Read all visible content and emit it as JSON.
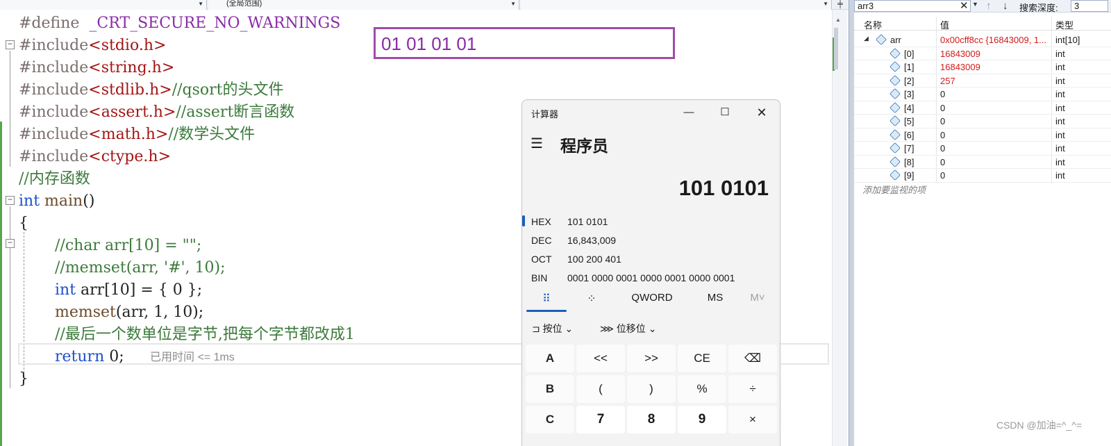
{
  "nav": {
    "combo_middle": "(全局范围)",
    "split_icon": "split-icon"
  },
  "code": {
    "lines": [
      {
        "pp": "#define",
        "rest": "_CRT_SECURE_NO_WARNINGS"
      },
      {
        "pp": "#include",
        "inc": "<stdio.h>"
      },
      {
        "pp": "#include",
        "inc": "<string.h>"
      },
      {
        "pp": "#include",
        "inc": "<stdlib.h>",
        "com": "//qsort的头文件"
      },
      {
        "pp": "#include",
        "inc": "<assert.h>",
        "com": "//assert断言函数"
      },
      {
        "pp": "#include",
        "inc": "<math.h>",
        "com": "//数学头文件"
      },
      {
        "pp": "#include",
        "inc": "<ctype.h>"
      },
      {
        "com": "//内存函数"
      },
      {
        "kw": "int",
        "fn": "main",
        "txt": "()"
      },
      {
        "txt": "{"
      },
      {
        "com": "//char arr[10] = \"\";"
      },
      {
        "com": "//memset(arr, '#', 10);"
      },
      {
        "kw": "int",
        "txt": " arr[10] = { 0 };"
      },
      {
        "fn": "memset",
        "txt": "(arr, 1, 10);"
      },
      {
        "com": "//最后一个数单位是字节,把每个字节都改成1"
      },
      {
        "kw": "return",
        "txt": " 0;"
      },
      {
        "txt": "}"
      }
    ],
    "elapsed_hint": "已用时间 <= 1ms"
  },
  "memory": {
    "text": "01 01 01 01"
  },
  "calculator": {
    "title": "计算器",
    "mode": "程序员",
    "display": "101 0101",
    "radix": [
      {
        "label": "HEX",
        "value": "101 0101"
      },
      {
        "label": "DEC",
        "value": "16,843,009"
      },
      {
        "label": "OCT",
        "value": "100 200 401"
      },
      {
        "label": "BIN",
        "value": "0001 0000 0001 0000 0001 0000 0001"
      }
    ],
    "tabs": {
      "keypad_icon": "keypad-icon",
      "bitflip_icon": "bit-toggle-icon",
      "word": "QWORD",
      "ms": "MS",
      "mv": "M˅"
    },
    "ops": {
      "bitwise": "按位",
      "shift": "位移位"
    },
    "keys": [
      [
        "A",
        "<<",
        ">>",
        "CE",
        "⌫"
      ],
      [
        "B",
        "(",
        ")",
        "%",
        "÷"
      ],
      [
        "C",
        "7",
        "8",
        "9",
        "×"
      ]
    ]
  },
  "watch": {
    "search_value": "arr3",
    "depth_label": "搜索深度:",
    "depth_value": "3",
    "headers": {
      "name": "名称",
      "value": "值",
      "type": "类型"
    },
    "root": {
      "name": "arr",
      "value": "0x00cff8cc {16843009, 1...",
      "type": "int[10]"
    },
    "items": [
      {
        "name": "[0]",
        "value": "16843009",
        "type": "int",
        "changed": true
      },
      {
        "name": "[1]",
        "value": "16843009",
        "type": "int",
        "changed": true
      },
      {
        "name": "[2]",
        "value": "257",
        "type": "int",
        "changed": true
      },
      {
        "name": "[3]",
        "value": "0",
        "type": "int",
        "changed": false
      },
      {
        "name": "[4]",
        "value": "0",
        "type": "int",
        "changed": false
      },
      {
        "name": "[5]",
        "value": "0",
        "type": "int",
        "changed": false
      },
      {
        "name": "[6]",
        "value": "0",
        "type": "int",
        "changed": false
      },
      {
        "name": "[7]",
        "value": "0",
        "type": "int",
        "changed": false
      },
      {
        "name": "[8]",
        "value": "0",
        "type": "int",
        "changed": false
      },
      {
        "name": "[9]",
        "value": "0",
        "type": "int",
        "changed": false
      }
    ],
    "add_hint": "添加要监视的项"
  },
  "watermark": "CSDN @加油=^_^=",
  "colors": {
    "keyword": "#1e50c8",
    "comment": "#3b7a3b",
    "include": "#a31515",
    "macro": "#8a2aa8",
    "changed_value": "#d11a1a",
    "calc_accent": "#1b5fb8"
  }
}
